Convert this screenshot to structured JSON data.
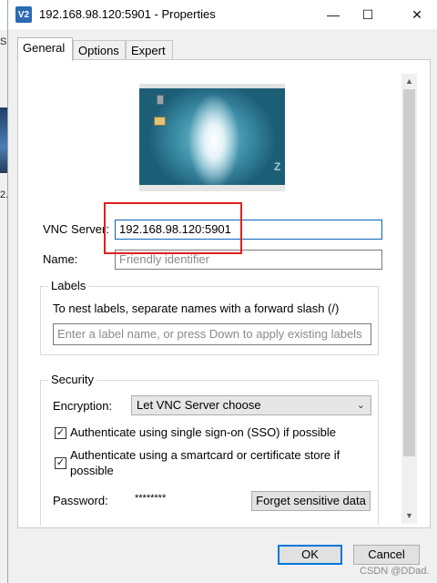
{
  "window": {
    "app_icon_text": "V2",
    "title": "192.168.98.120:5901 - Properties",
    "minimize_glyph": "—",
    "maximize_glyph": "☐",
    "close_glyph": "✕"
  },
  "background": {
    "fragment_top": "S",
    "fragment_bottom": "2."
  },
  "tabs": [
    {
      "label": "General",
      "active": true
    },
    {
      "label": "Options",
      "active": false
    },
    {
      "label": "Expert",
      "active": false
    }
  ],
  "general": {
    "vnc_server_label": "VNC Server:",
    "vnc_server_value": "192.168.98.120:5901",
    "name_label": "Name:",
    "name_placeholder": "Friendly identifier",
    "labels_group_title": "Labels",
    "labels_hint": "To nest labels, separate names with a forward slash (/)",
    "labels_placeholder": "Enter a label name, or press Down to apply existing labels",
    "security_group_title": "Security",
    "encryption_label": "Encryption:",
    "encryption_value": "Let VNC Server choose",
    "sso_label": "Authenticate using single sign-on (SSO) if possible",
    "sso_checked": true,
    "smartcard_label_line1": "Authenticate using a smartcard or certificate store if",
    "smartcard_label_line2": "possible",
    "smartcard_checked": true,
    "password_label": "Password:",
    "password_value": "********",
    "forget_button": "Forget sensitive data"
  },
  "footer": {
    "ok_label": "OK",
    "cancel_label": "Cancel"
  },
  "watermark": "CSDN @DDad.",
  "colors": {
    "highlight_box": "#e02020",
    "focus_border": "#0a64b8",
    "accent": "#0078d7"
  }
}
